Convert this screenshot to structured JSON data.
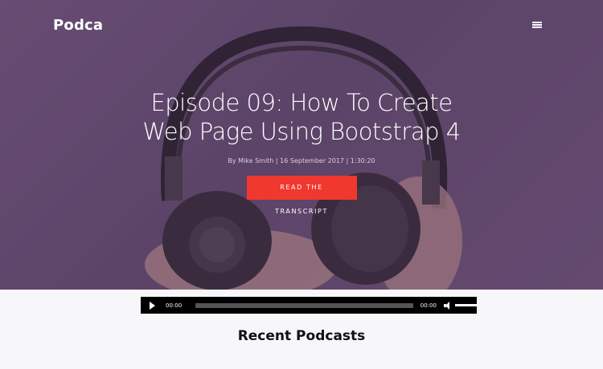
{
  "navbar": {
    "brand": "Podca"
  },
  "hero": {
    "title": "Episode 09: How To Create Web Page Using Bootstrap 4",
    "meta": "By Mike Smith | 16 September 2017 | 1:30:20",
    "cta_label": "READ THE TRANSCRIPT",
    "cta_color": "#f0382e"
  },
  "player": {
    "current_time": "00:00",
    "total_time": "00:00",
    "volume": 1.0,
    "progress": 0.0
  },
  "recent": {
    "title": "Recent Podcasts"
  },
  "icons": {
    "menu": "hamburger-menu-icon",
    "play": "play-icon",
    "volume": "volume-icon"
  }
}
